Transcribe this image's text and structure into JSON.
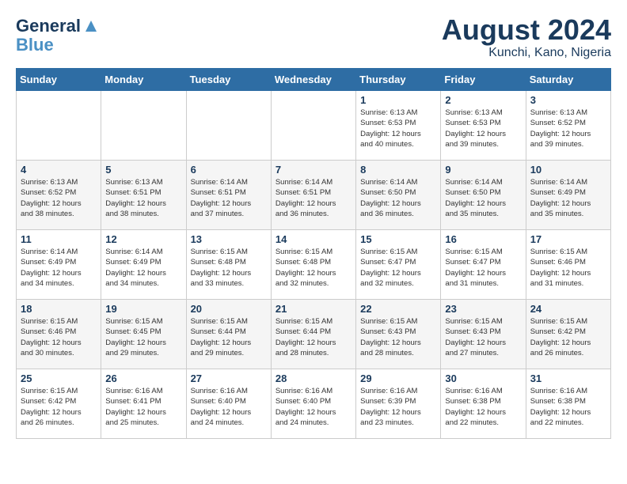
{
  "header": {
    "logo_line1": "General",
    "logo_line2": "Blue",
    "month": "August 2024",
    "location": "Kunchi, Kano, Nigeria"
  },
  "weekdays": [
    "Sunday",
    "Monday",
    "Tuesday",
    "Wednesday",
    "Thursday",
    "Friday",
    "Saturday"
  ],
  "weeks": [
    [
      {
        "day": "",
        "info": ""
      },
      {
        "day": "",
        "info": ""
      },
      {
        "day": "",
        "info": ""
      },
      {
        "day": "",
        "info": ""
      },
      {
        "day": "1",
        "info": "Sunrise: 6:13 AM\nSunset: 6:53 PM\nDaylight: 12 hours\nand 40 minutes."
      },
      {
        "day": "2",
        "info": "Sunrise: 6:13 AM\nSunset: 6:53 PM\nDaylight: 12 hours\nand 39 minutes."
      },
      {
        "day": "3",
        "info": "Sunrise: 6:13 AM\nSunset: 6:52 PM\nDaylight: 12 hours\nand 39 minutes."
      }
    ],
    [
      {
        "day": "4",
        "info": "Sunrise: 6:13 AM\nSunset: 6:52 PM\nDaylight: 12 hours\nand 38 minutes."
      },
      {
        "day": "5",
        "info": "Sunrise: 6:13 AM\nSunset: 6:51 PM\nDaylight: 12 hours\nand 38 minutes."
      },
      {
        "day": "6",
        "info": "Sunrise: 6:14 AM\nSunset: 6:51 PM\nDaylight: 12 hours\nand 37 minutes."
      },
      {
        "day": "7",
        "info": "Sunrise: 6:14 AM\nSunset: 6:51 PM\nDaylight: 12 hours\nand 36 minutes."
      },
      {
        "day": "8",
        "info": "Sunrise: 6:14 AM\nSunset: 6:50 PM\nDaylight: 12 hours\nand 36 minutes."
      },
      {
        "day": "9",
        "info": "Sunrise: 6:14 AM\nSunset: 6:50 PM\nDaylight: 12 hours\nand 35 minutes."
      },
      {
        "day": "10",
        "info": "Sunrise: 6:14 AM\nSunset: 6:49 PM\nDaylight: 12 hours\nand 35 minutes."
      }
    ],
    [
      {
        "day": "11",
        "info": "Sunrise: 6:14 AM\nSunset: 6:49 PM\nDaylight: 12 hours\nand 34 minutes."
      },
      {
        "day": "12",
        "info": "Sunrise: 6:14 AM\nSunset: 6:49 PM\nDaylight: 12 hours\nand 34 minutes."
      },
      {
        "day": "13",
        "info": "Sunrise: 6:15 AM\nSunset: 6:48 PM\nDaylight: 12 hours\nand 33 minutes."
      },
      {
        "day": "14",
        "info": "Sunrise: 6:15 AM\nSunset: 6:48 PM\nDaylight: 12 hours\nand 32 minutes."
      },
      {
        "day": "15",
        "info": "Sunrise: 6:15 AM\nSunset: 6:47 PM\nDaylight: 12 hours\nand 32 minutes."
      },
      {
        "day": "16",
        "info": "Sunrise: 6:15 AM\nSunset: 6:47 PM\nDaylight: 12 hours\nand 31 minutes."
      },
      {
        "day": "17",
        "info": "Sunrise: 6:15 AM\nSunset: 6:46 PM\nDaylight: 12 hours\nand 31 minutes."
      }
    ],
    [
      {
        "day": "18",
        "info": "Sunrise: 6:15 AM\nSunset: 6:46 PM\nDaylight: 12 hours\nand 30 minutes."
      },
      {
        "day": "19",
        "info": "Sunrise: 6:15 AM\nSunset: 6:45 PM\nDaylight: 12 hours\nand 29 minutes."
      },
      {
        "day": "20",
        "info": "Sunrise: 6:15 AM\nSunset: 6:44 PM\nDaylight: 12 hours\nand 29 minutes."
      },
      {
        "day": "21",
        "info": "Sunrise: 6:15 AM\nSunset: 6:44 PM\nDaylight: 12 hours\nand 28 minutes."
      },
      {
        "day": "22",
        "info": "Sunrise: 6:15 AM\nSunset: 6:43 PM\nDaylight: 12 hours\nand 28 minutes."
      },
      {
        "day": "23",
        "info": "Sunrise: 6:15 AM\nSunset: 6:43 PM\nDaylight: 12 hours\nand 27 minutes."
      },
      {
        "day": "24",
        "info": "Sunrise: 6:15 AM\nSunset: 6:42 PM\nDaylight: 12 hours\nand 26 minutes."
      }
    ],
    [
      {
        "day": "25",
        "info": "Sunrise: 6:15 AM\nSunset: 6:42 PM\nDaylight: 12 hours\nand 26 minutes."
      },
      {
        "day": "26",
        "info": "Sunrise: 6:16 AM\nSunset: 6:41 PM\nDaylight: 12 hours\nand 25 minutes."
      },
      {
        "day": "27",
        "info": "Sunrise: 6:16 AM\nSunset: 6:40 PM\nDaylight: 12 hours\nand 24 minutes."
      },
      {
        "day": "28",
        "info": "Sunrise: 6:16 AM\nSunset: 6:40 PM\nDaylight: 12 hours\nand 24 minutes."
      },
      {
        "day": "29",
        "info": "Sunrise: 6:16 AM\nSunset: 6:39 PM\nDaylight: 12 hours\nand 23 minutes."
      },
      {
        "day": "30",
        "info": "Sunrise: 6:16 AM\nSunset: 6:38 PM\nDaylight: 12 hours\nand 22 minutes."
      },
      {
        "day": "31",
        "info": "Sunrise: 6:16 AM\nSunset: 6:38 PM\nDaylight: 12 hours\nand 22 minutes."
      }
    ]
  ]
}
